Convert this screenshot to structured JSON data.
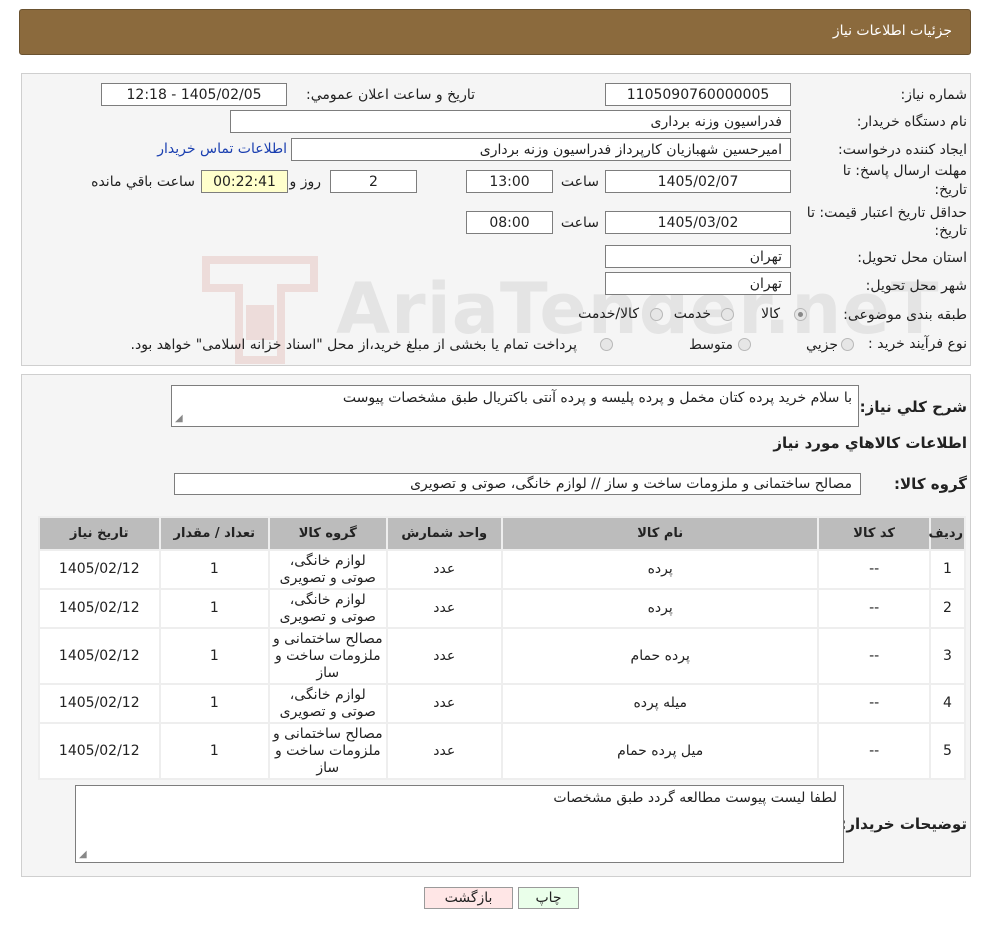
{
  "header": {
    "title": "جزئیات اطلاعات نیاز"
  },
  "watermark": {
    "text": "AriaTender.neT"
  },
  "form": {
    "need_number_label": "شماره نیاز:",
    "need_number": "1105090760000005",
    "announce_label": "تاریخ و ساعت اعلان عمومي:",
    "announce_value": "1405/02/05 - 12:18",
    "buyer_org_label": "نام دستگاه خريدار:",
    "buyer_org": "فدراسیون وزنه برداری",
    "creator_label": "ايجاد کننده درخواست:",
    "creator": "امیرحسین شهبازیان کارپرداز فدراسیون وزنه برداری",
    "contact_link": "اطلاعات تماس خريدار",
    "deadline_label_1": "مهلت ارسال پاسخ: تا",
    "deadline_label_2": "تاريخ:",
    "deadline_date": "1405/02/07",
    "time_label": "ساعت",
    "deadline_time": "13:00",
    "days_value": "2",
    "days_label": "روز و",
    "remaining_time": "00:22:41",
    "remaining_label": "ساعت باقي مانده",
    "validity_label_1": "حداقل تاريخ اعتبار قيمت: تا",
    "validity_label_2": "تاريخ:",
    "validity_date": "1405/03/02",
    "validity_time": "08:00",
    "province_label": "استان محل تحويل:",
    "province": "تهران",
    "city_label": "شهر محل تحويل:",
    "city": "تهران",
    "category_label": "طبقه بندی موضوعی:",
    "category_options": [
      "کالا",
      "خدمت",
      "کالا/خدمت"
    ],
    "process_label": "نوع فرآيند خريد :",
    "process_options": [
      "جزيي",
      "متوسط"
    ],
    "process_note": "پرداخت تمام يا بخشی از مبلغ خريد،از محل \"اسناد خزانه اسلامی\" خواهد بود."
  },
  "description": {
    "label": "شرح کلي نياز:",
    "text": "با سلام خرید پرده کتان مخمل و پرده پلیسه و پرده آنتی باکتریال طبق مشخصات پیوست"
  },
  "goods": {
    "section_title": "اطلاعات کالاهاي مورد نياز",
    "group_label": "گروه کالا:",
    "group_value": "مصالح ساختمانی و ملزومات ساخت و ساز // لوازم خانگی، صوتی و تصویری"
  },
  "table": {
    "headers": [
      "رديف",
      "کد کالا",
      "نام کالا",
      "واحد شمارش",
      "گروه کالا",
      "تعداد / مقدار",
      "تاريخ نياز"
    ],
    "rows": [
      {
        "index": "1",
        "code": "--",
        "name": "پرده",
        "unit": "عدد",
        "group": "لوازم خانگی، صوتی و تصویری",
        "qty": "1",
        "date": "1405/02/12"
      },
      {
        "index": "2",
        "code": "--",
        "name": "پرده",
        "unit": "عدد",
        "group": "لوازم خانگی، صوتی و تصویری",
        "qty": "1",
        "date": "1405/02/12"
      },
      {
        "index": "3",
        "code": "--",
        "name": "پرده حمام",
        "unit": "عدد",
        "group": "مصالح ساختمانی و ملزومات ساخت و ساز",
        "qty": "1",
        "date": "1405/02/12"
      },
      {
        "index": "4",
        "code": "--",
        "name": "میله پرده",
        "unit": "عدد",
        "group": "لوازم خانگی، صوتی و تصویری",
        "qty": "1",
        "date": "1405/02/12"
      },
      {
        "index": "5",
        "code": "--",
        "name": "میل پرده حمام",
        "unit": "عدد",
        "group": "مصالح ساختمانی و ملزومات ساخت و ساز",
        "qty": "1",
        "date": "1405/02/12"
      }
    ]
  },
  "buyer_notes": {
    "label": "توضيحات خريدار:",
    "text": "لطفا لیست پیوست مطالعه گردد طبق مشخصات"
  },
  "buttons": {
    "print": "چاپ",
    "back": "بازگشت"
  },
  "colors": {
    "header_bg": "#8b6a3d",
    "print_bg": "#eaffea",
    "back_bg": "#ffe6e6",
    "link": "#1a3fb0"
  }
}
